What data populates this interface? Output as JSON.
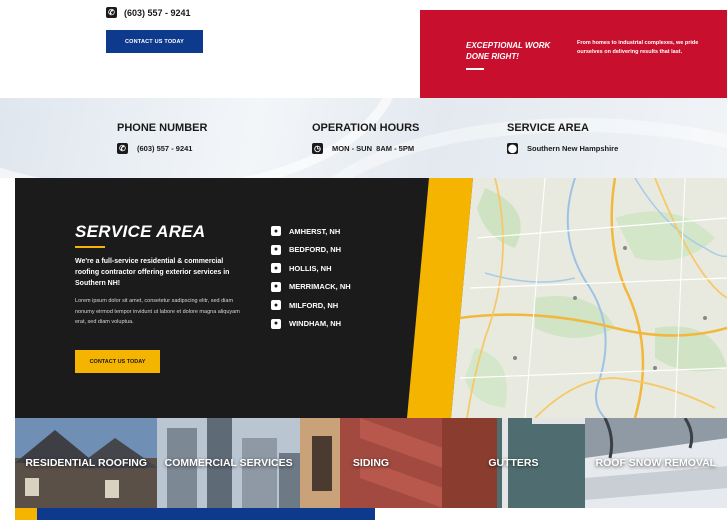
{
  "top": {
    "phone": "(603) 557 - 9241",
    "contact_button": "CONTACT US TODAY",
    "promo_title": "EXCEPTIONAL WORK DONE RIGHT!",
    "promo_text": "From homes to industrial complexes, we pride ourselves on delivering results that last."
  },
  "info": {
    "phone_title": "PHONE NUMBER",
    "phone_value": "(603) 557 - 9241",
    "hours_title": "OPERATION HOURS",
    "hours_value": "MON - SUN  8AM - 5PM",
    "area_title": "SERVICE AREA",
    "area_value": "Southern New Hampshire"
  },
  "service": {
    "title": "SERVICE AREA",
    "lead": "We're a full-service residential & commercial roofing contractor offering exterior services in Southern NH!",
    "body": "Lorem ipsum dolor sit amet, consetetur sadipscing elitr, sed diam nonumy eirmod tempor invidunt ut labore et dolore magna aliquyam erat, sed diam voluptua.",
    "button": "CONTACT US TODAY",
    "towns": [
      "AMHERST, NH",
      "BEDFORD, NH",
      "HOLLIS, NH",
      "MERRIMACK, NH",
      "MILFORD, NH",
      "WINDHAM, NH"
    ]
  },
  "tiles": [
    "RESIDENTIAL ROOFING",
    "COMMERCIAL SERVICES",
    "SIDING",
    "GUTTERS",
    "ROOF SNOW REMOVAL"
  ],
  "colors": {
    "navy": "#0d3a8c",
    "red": "#c8102e",
    "yellow": "#f5b400",
    "dark": "#1b1b1b"
  },
  "icons": {
    "phone": "phone-icon",
    "clock": "clock-icon",
    "pin": "map-pin-icon"
  }
}
